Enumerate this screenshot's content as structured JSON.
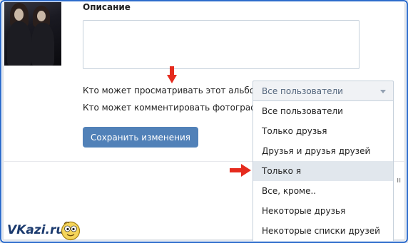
{
  "form": {
    "description_label": "Описание",
    "description_value": "",
    "privacy_view_label": "Кто может просматривать этот альбом?",
    "privacy_comment_label": "Кто может комментировать фотографии?",
    "save_button_label": "Сохранить изменения"
  },
  "privacy_select": {
    "selected": "Все пользователи",
    "options": [
      "Все пользователи",
      "Только друзья",
      "Друзья и друзья друзей",
      "Только я",
      "Все, кроме..",
      "Некоторые друзья",
      "Некоторые списки друзей"
    ],
    "highlighted_option": "Только я"
  },
  "brand": {
    "text": "VKazi.ru"
  },
  "colors": {
    "button": "#5181b8",
    "arrow": "#e52b1e",
    "highlight": "#e1e7ed",
    "frame": "#2d6ccc"
  }
}
